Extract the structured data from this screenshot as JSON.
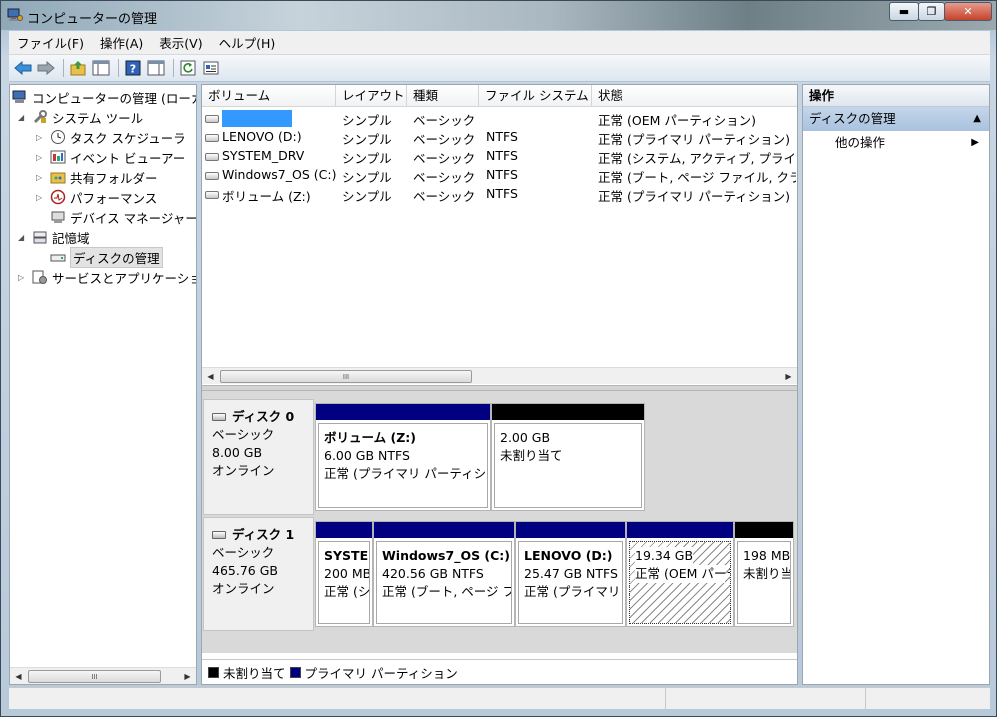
{
  "window": {
    "title": "コンピューターの管理"
  },
  "menu": [
    "ファイル(F)",
    "操作(A)",
    "表示(V)",
    "ヘルプ(H)"
  ],
  "tree": {
    "root": "コンピューターの管理 (ローカ",
    "system_tools": "システム ツール",
    "task_scheduler": "タスク スケジューラ",
    "event_viewer": "イベント ビューアー",
    "shared_folders": "共有フォルダー",
    "performance": "パフォーマンス",
    "device_manager": "デバイス マネージャー",
    "storage": "記憶域",
    "disk_management": "ディスクの管理",
    "services": "サービスとアプリケーショ"
  },
  "volume_list": {
    "columns": [
      "ボリューム",
      "レイアウト",
      "種類",
      "ファイル システム",
      "状態"
    ],
    "rows": [
      {
        "volume": "",
        "layout": "シンプル",
        "type": "ベーシック",
        "fs": "",
        "status": "正常 (OEM パーティション)"
      },
      {
        "volume": "LENOVO (D:)",
        "layout": "シンプル",
        "type": "ベーシック",
        "fs": "NTFS",
        "status": "正常 (プライマリ パーティション)"
      },
      {
        "volume": "SYSTEM_DRV",
        "layout": "シンプル",
        "type": "ベーシック",
        "fs": "NTFS",
        "status": "正常 (システム, アクティブ, プライマ"
      },
      {
        "volume": "Windows7_OS (C:)",
        "layout": "シンプル",
        "type": "ベーシック",
        "fs": "NTFS",
        "status": "正常 (ブート, ページ ファイル, クラ"
      },
      {
        "volume": "ボリューム (Z:)",
        "layout": "シンプル",
        "type": "ベーシック",
        "fs": "NTFS",
        "status": "正常 (プライマリ パーティション)"
      }
    ],
    "scroll_thumb": "III"
  },
  "disks": [
    {
      "name": "ディスク 0",
      "type": "ベーシック",
      "size": "8.00 GB",
      "state": "オンライン",
      "partitions": [
        {
          "name": "ボリューム (Z:)",
          "size": "6.00 GB NTFS",
          "status": "正常 (プライマリ パーティシ:",
          "bar": "primary"
        },
        {
          "name": "",
          "size": "2.00 GB",
          "status": "未割り当て",
          "bar": "unallocated"
        }
      ]
    },
    {
      "name": "ディスク 1",
      "type": "ベーシック",
      "size": "465.76 GB",
      "state": "オンライン",
      "partitions": [
        {
          "name": "SYSTEI",
          "size": "200 MB",
          "status": "正常 (シ",
          "bar": "primary"
        },
        {
          "name": "Windows7_OS  (C:)",
          "size": "420.56 GB NTFS",
          "status": "正常 (ブート, ページ フ",
          "bar": "primary"
        },
        {
          "name": "LENOVO  (D:)",
          "size": "25.47 GB NTFS",
          "status": "正常 (プライマリ",
          "bar": "primary"
        },
        {
          "name": "",
          "size": "19.34 GB",
          "status": "正常 (OEM パーテ",
          "bar": "primary"
        },
        {
          "name": "",
          "size": "198 MB",
          "status": "未割り当",
          "bar": "unallocated"
        }
      ]
    }
  ],
  "legend": {
    "unallocated": "未割り当て",
    "primary": "プライマリ パーティション"
  },
  "colors": {
    "primary": "#000080",
    "unallocated": "#000000",
    "selection": "#3399ff"
  },
  "actions": {
    "header": "操作",
    "section": "ディスクの管理",
    "item": "他の操作"
  },
  "left_scroll_thumb": "III"
}
